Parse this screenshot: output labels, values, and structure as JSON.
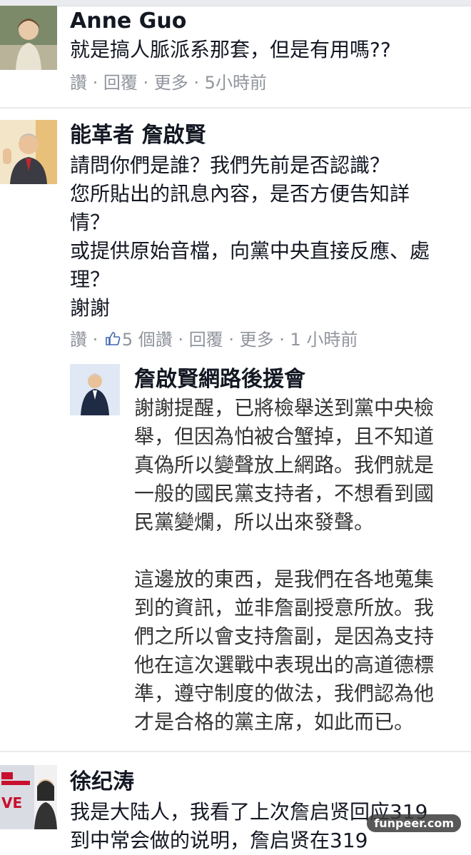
{
  "comments": [
    {
      "author": "Anne Guo",
      "text": "就是搞人脈派系那套，但是有用嗎??",
      "actions": {
        "like": "讚",
        "reply": "回覆",
        "more": "更多",
        "time": "5小時前"
      }
    },
    {
      "author": "能革者 詹啟賢",
      "text": "請問你們是誰？我們先前是否認識？\n您所貼出的訊息內容，是否方便告知詳\n情？\n或提供原始音檔，向黨中央直接反應、處\n理？\n謝謝",
      "actions": {
        "like": "讚",
        "like_count": "5 個讚",
        "reply": "回覆",
        "more": "更多",
        "time": "1 小時前"
      },
      "reply": {
        "author": "詹啟賢網路後援會",
        "text": "謝謝提醒，已將檢舉送到黨中央檢\n舉，但因為怕被合蟹掉，且不知道\n真偽所以變聲放上網路。我們就是\n一般的國民黨支持者，不想看到國\n民黨變爛，所以出來發聲。\n\n這邊放的東西，是我們在各地蒐集\n到的資訊，並非詹副授意所放。我\n們之所以會支持詹副，是因為支持\n他在這次選戰中表現出的高道德標\n準，遵守制度的做法，我們認為他\n才是合格的黨主席，如此而已。"
      }
    },
    {
      "author": "徐纪涛",
      "text": "我是大陆人，我看了上次詹启贤回应319\n到中常会做的说明，詹启贤在319"
    }
  ],
  "avatar_labels": {
    "third": "VE"
  },
  "watermark": "funpeer.com",
  "colors": {
    "meta": "#90949c",
    "divider": "#e9ebee",
    "like_blue": "#4267b2"
  }
}
